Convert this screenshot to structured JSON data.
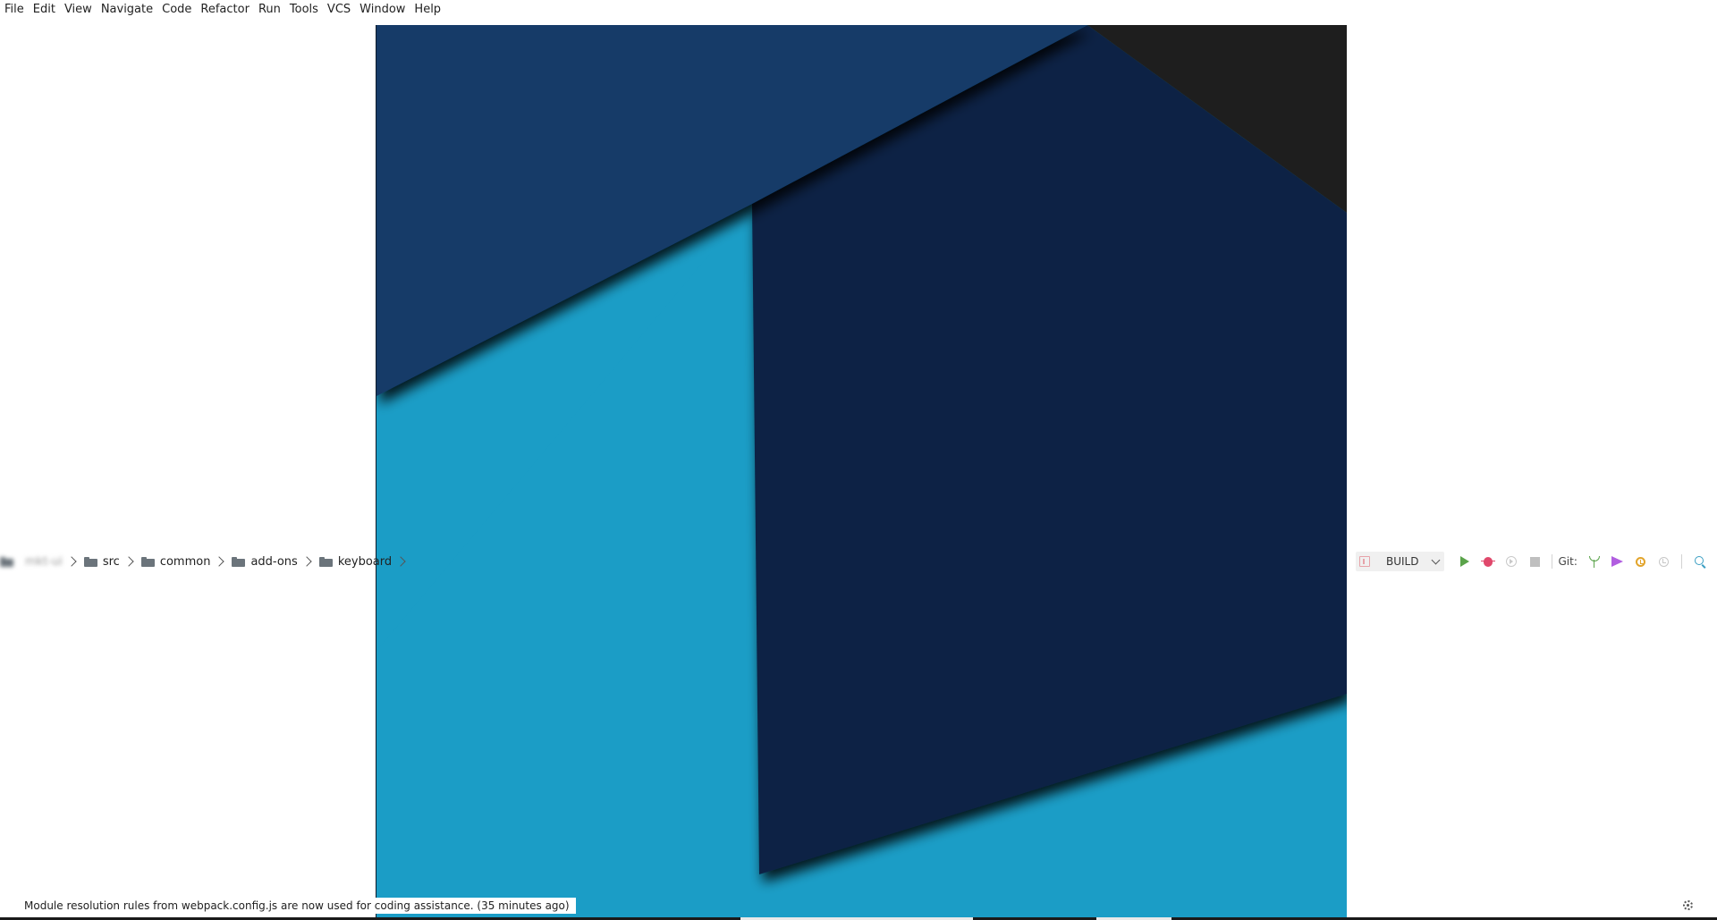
{
  "menu": {
    "items": [
      {
        "label": "File"
      },
      {
        "label": "Edit"
      },
      {
        "label": "View"
      },
      {
        "label": "Navigate"
      },
      {
        "label": "Code"
      },
      {
        "label": "Refactor"
      },
      {
        "label": "Run"
      },
      {
        "label": "Tools"
      },
      {
        "label": "VCS"
      },
      {
        "label": "Window"
      },
      {
        "label": "Help"
      }
    ]
  },
  "breadcrumb": {
    "project": "mkt-ui",
    "items": [
      {
        "label": "src",
        "icon": "folder-icon"
      },
      {
        "label": "common",
        "icon": "folder-icon"
      },
      {
        "label": "add-ons",
        "icon": "folder-icon"
      },
      {
        "label": "keyboard",
        "icon": "folder-icon"
      }
    ]
  },
  "toolbar": {
    "run_config": "BUILD",
    "git_label": "Git:",
    "icons": {
      "run": "play-icon",
      "debug": "bug-icon",
      "profile": "profile-icon",
      "stop": "stop-icon",
      "branch": "git-branch-icon",
      "push": "push-icon",
      "history": "history-icon",
      "rollback": "rollback-icon",
      "search": "search-icon"
    },
    "colors": {
      "run": "#5aa34a",
      "debug": "#e0486b",
      "push": "#b15ee0",
      "history": "#e2a42b",
      "search": "#3a9ec2"
    }
  },
  "status": {
    "message": "Module resolution rules from webpack.config.js are now used for coding assistance. (35 minutes ago)"
  },
  "wallpaper": {
    "colors": {
      "light_blue": "#1b9dc6",
      "navy": "#123a67",
      "dark_navy": "#0b2444",
      "charcoal": "#1e1e1e"
    }
  }
}
